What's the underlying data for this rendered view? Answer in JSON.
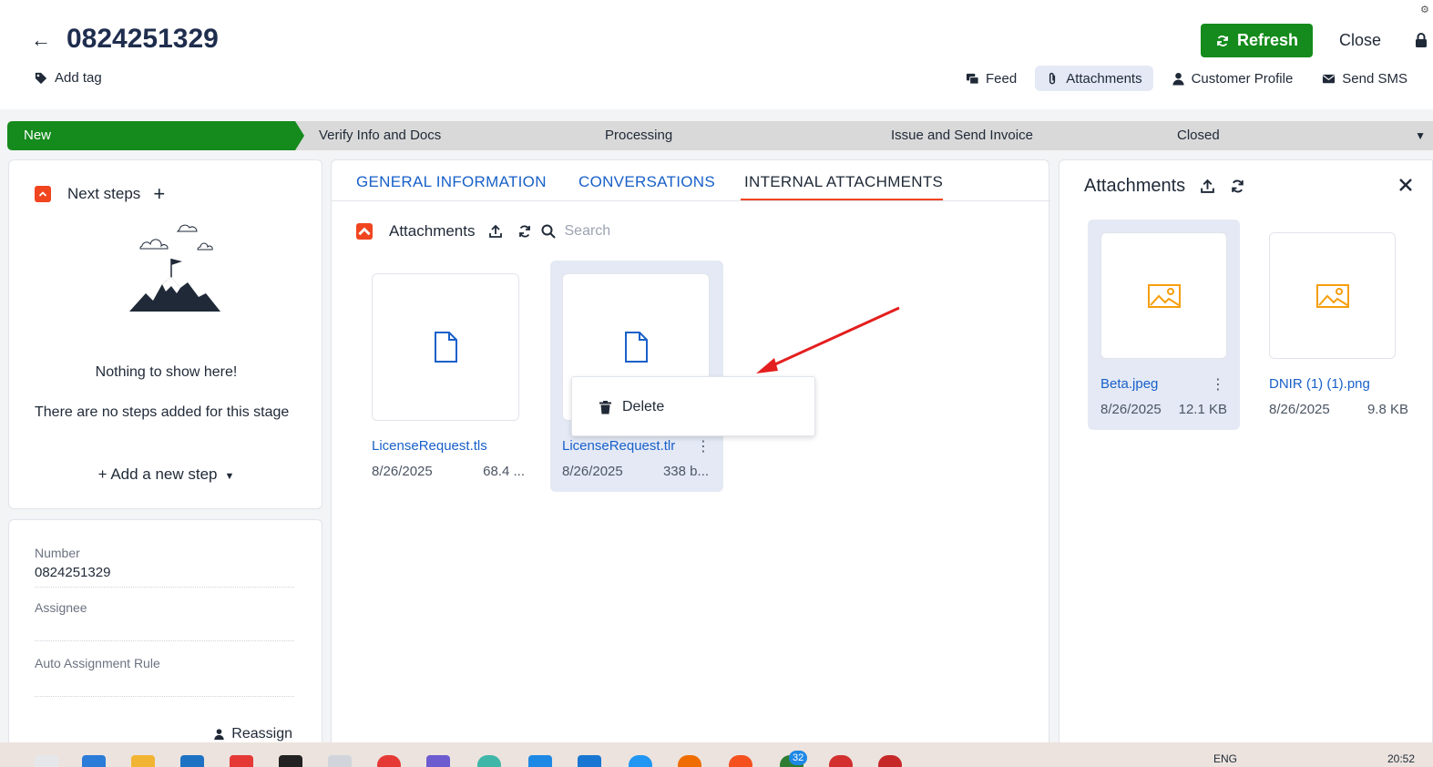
{
  "header": {
    "record_number": "0824251329",
    "add_tag_label": "Add tag",
    "refresh_label": "Refresh",
    "close_label": "Close",
    "nav_tabs": [
      {
        "label": "Feed"
      },
      {
        "label": "Attachments"
      },
      {
        "label": "Customer Profile"
      },
      {
        "label": "Send SMS"
      }
    ]
  },
  "stages": [
    {
      "label": "New",
      "active": true
    },
    {
      "label": "Verify Info and Docs"
    },
    {
      "label": "Processing"
    },
    {
      "label": "Issue and Send Invoice"
    },
    {
      "label": "Closed"
    }
  ],
  "next_steps": {
    "title": "Next steps",
    "empty_title": "Nothing to show here!",
    "empty_text": "There are no steps added for this stage",
    "add_label": "Add a new step"
  },
  "details": {
    "number_label": "Number",
    "number_value": "0824251329",
    "assignee_label": "Assignee",
    "assignee_value": "",
    "auto_rule_label": "Auto Assignment Rule",
    "auto_rule_value": "",
    "reassign_label": "Reassign"
  },
  "main_tabs": [
    {
      "label": "GENERAL INFORMATION"
    },
    {
      "label": "CONVERSATIONS"
    },
    {
      "label": "INTERNAL ATTACHMENTS",
      "active": true
    }
  ],
  "internal_attachments": {
    "title": "Attachments",
    "search_placeholder": "Search",
    "files": [
      {
        "name": "LicenseRequest.tls",
        "date": "8/26/2025",
        "size": "68.4 ..."
      },
      {
        "name": "LicenseRequest.tlr",
        "date": "8/26/2025",
        "size": "338 b...",
        "selected": true
      }
    ],
    "context_menu": [
      {
        "label": "Delete"
      }
    ]
  },
  "attachments_panel": {
    "title": "Attachments",
    "files": [
      {
        "name": "Beta.jpeg",
        "date": "8/26/2025",
        "size": "12.1 KB",
        "selected": true
      },
      {
        "name": "DNIR (1) (1).png",
        "date": "8/26/2025",
        "size": "9.8 KB"
      }
    ]
  },
  "taskbar": {
    "badge_count": "32",
    "language": "ENG",
    "time": "20:52"
  },
  "colors": {
    "accent_green": "#148b1c",
    "link_blue": "#1860c9",
    "alert_red": "#f0451f",
    "icon_orange": "#f59e0b"
  }
}
